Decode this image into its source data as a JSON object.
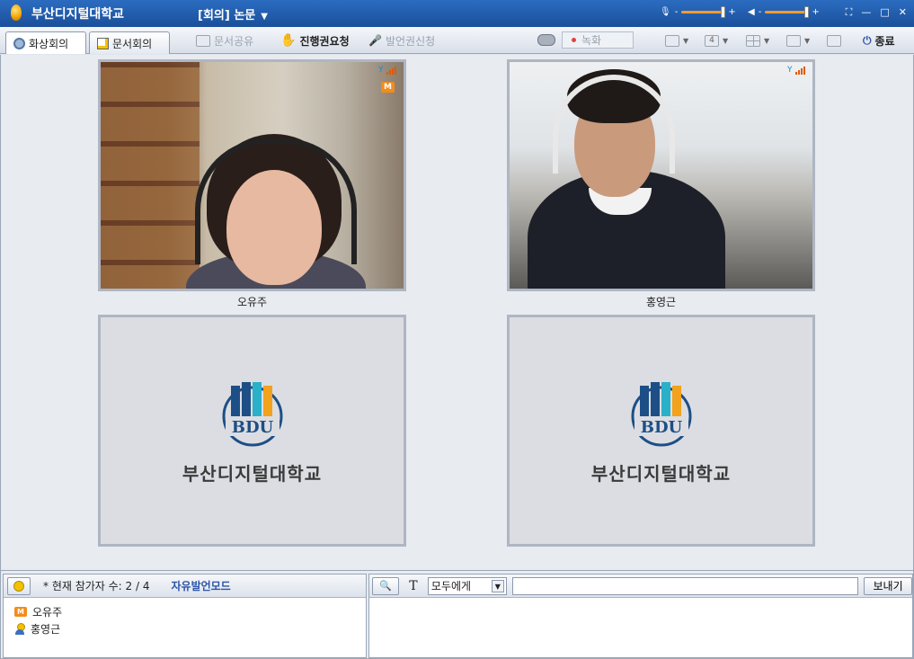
{
  "window": {
    "app_title": "부산디지털대학교",
    "meeting_title": "[회의] 논문"
  },
  "toolbar": {
    "tabs": [
      {
        "label": "화상회의"
      },
      {
        "label": "문서회의"
      }
    ],
    "share_doc": "문서공유",
    "request_lead": "진행권요청",
    "request_speak": "발언권신청",
    "record": "녹화",
    "layout_count": "4",
    "exit": "종료"
  },
  "participants_video": [
    {
      "name": "오유주"
    },
    {
      "name": "홍영근"
    }
  ],
  "empty_slot": {
    "logo_text": "BDU",
    "school_name": "부산디지털대학교"
  },
  "participants_panel": {
    "count_label": "* 현재 참가자 수: 2 / 4",
    "mode_label": "자유발언모드",
    "list": [
      {
        "name": "오유주",
        "role_badge": "M"
      },
      {
        "name": "홍영근",
        "role_badge": ""
      }
    ]
  },
  "chat": {
    "recipient": "모두에게",
    "input_value": "",
    "send_label": "보내기"
  },
  "colors": {
    "titlebar": "#1a4f9a",
    "accent_orange": "#f28c1c",
    "mode_blue": "#2c55a8"
  }
}
